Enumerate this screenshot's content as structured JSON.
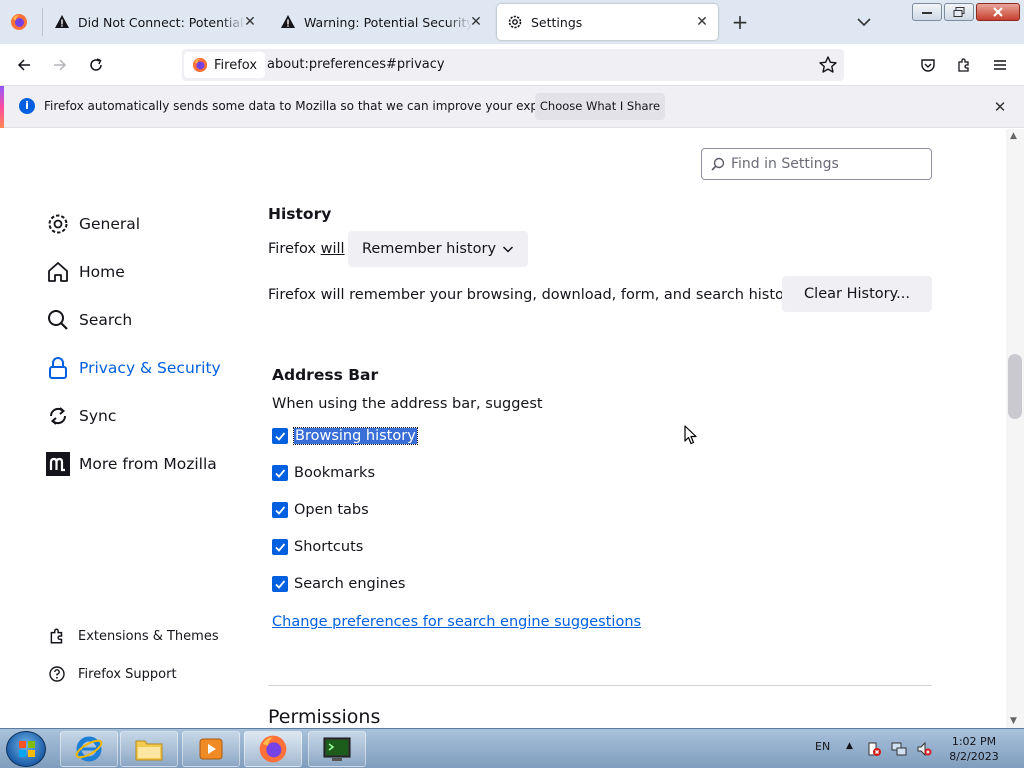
{
  "tabs": [
    {
      "title": "Did Not Connect: Potential Security Issue",
      "icon": "warning-icon"
    },
    {
      "title": "Warning: Potential Security Risk Ahead",
      "icon": "warning-icon"
    },
    {
      "title": "Settings",
      "icon": "gear-icon",
      "active": true
    }
  ],
  "navbar": {
    "identity_label": "Firefox",
    "url": "about:preferences#privacy"
  },
  "notification": {
    "message": "Firefox automatically sends some data to Mozilla so that we can improve your experience.",
    "button_label": "Choose What I Share"
  },
  "search": {
    "placeholder": "Find in Settings"
  },
  "sidebar": {
    "items": [
      {
        "label": "General",
        "icon": "gear-icon"
      },
      {
        "label": "Home",
        "icon": "home-icon"
      },
      {
        "label": "Search",
        "icon": "search-icon"
      },
      {
        "label": "Privacy & Security",
        "icon": "lock-icon",
        "selected": true
      },
      {
        "label": "Sync",
        "icon": "sync-icon"
      },
      {
        "label": "More from Mozilla",
        "icon": "mozilla-icon"
      }
    ],
    "footer": [
      {
        "label": "Extensions & Themes",
        "icon": "puzzle-icon"
      },
      {
        "label": "Firefox Support",
        "icon": "help-icon"
      }
    ]
  },
  "history": {
    "heading": "History",
    "will_prefix": "Firefox ",
    "will_word": "will",
    "dropdown_value": "Remember history",
    "description": "Firefox will remember your browsing, download, form, and search history.",
    "clear_button": "Clear History..."
  },
  "address_bar": {
    "heading": "Address Bar",
    "description": "When using the address bar, suggest",
    "options": [
      {
        "label": "Browsing history",
        "checked": true
      },
      {
        "label": "Bookmarks",
        "checked": true
      },
      {
        "label": "Open tabs",
        "checked": true
      },
      {
        "label": "Shortcuts",
        "checked": true
      },
      {
        "label": "Search engines",
        "checked": true
      }
    ],
    "link": "Change preferences for search engine suggestions"
  },
  "permissions": {
    "heading": "Permissions"
  },
  "taskbar": {
    "items": [
      "internet-explorer-icon",
      "file-explorer-icon",
      "media-player-icon",
      "firefox-icon",
      "terminal-icon"
    ],
    "lang": "EN",
    "time": "1:02 PM",
    "date": "8/2/2023"
  },
  "colors": {
    "accent": "#0060df",
    "selection": "#3a6fd8"
  }
}
